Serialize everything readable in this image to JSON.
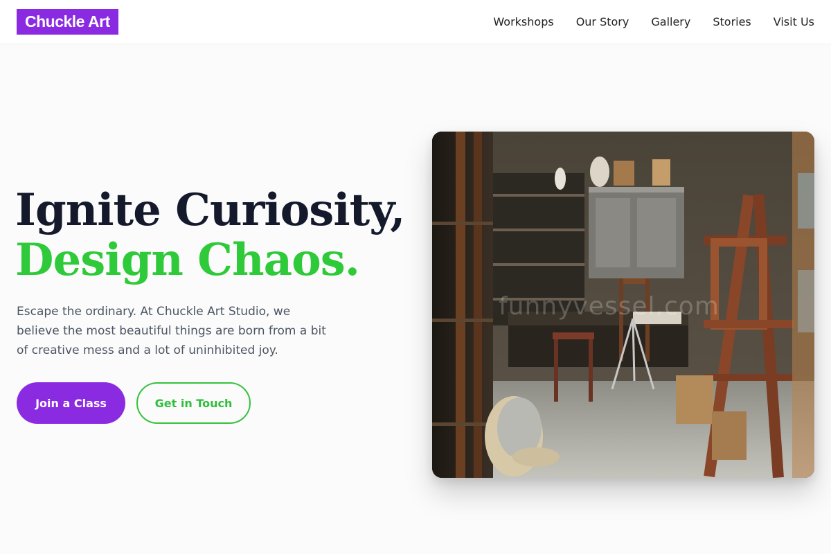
{
  "header": {
    "logo": "Chuckle Art",
    "nav": [
      "Workshops",
      "Our Story",
      "Gallery",
      "Stories",
      "Visit Us"
    ]
  },
  "hero": {
    "title_line1": "Ignite Curiosity,",
    "title_line2": "Design Chaos.",
    "description": "Escape the ordinary. At Chuckle Art Studio, we believe the most beautiful things are born from a bit of creative mess and a lot of uninhibited joy.",
    "primary_button": "Join a Class",
    "secondary_button": "Get in Touch",
    "image_watermark": "funnyvessel.com"
  },
  "colors": {
    "brand_purple": "#8a2be2",
    "accent_green": "#2fca3a",
    "heading_dark": "#141a2c"
  }
}
